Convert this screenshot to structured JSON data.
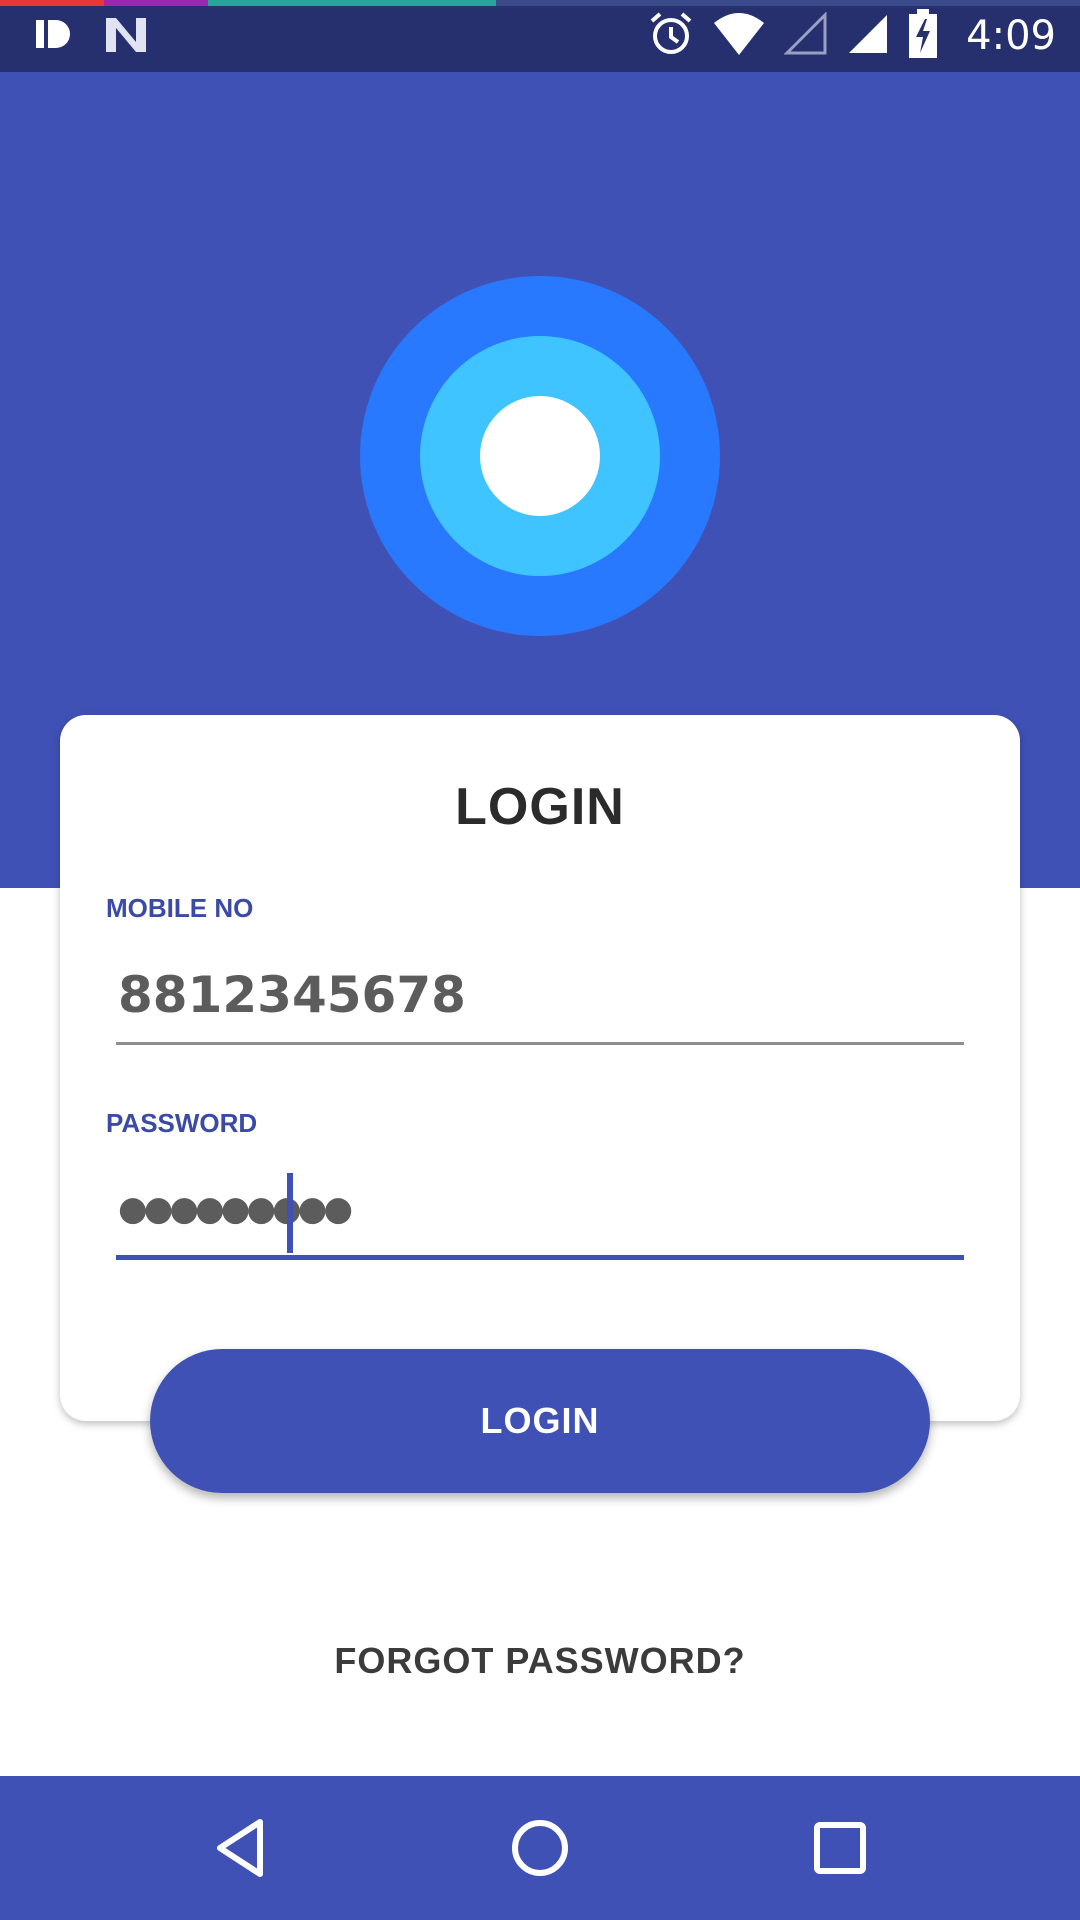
{
  "status_bar": {
    "time": "4:09",
    "left_icons": [
      "id-app-icon",
      "n-app-icon"
    ],
    "right_icons": [
      "alarm-icon",
      "wifi-icon",
      "signal-empty-icon",
      "signal-icon",
      "battery-charging-icon"
    ]
  },
  "card": {
    "title": "LOGIN"
  },
  "form": {
    "mobile_label": "MOBILE NO",
    "mobile_value": "8812345678",
    "password_label": "PASSWORD",
    "password_value": "●●●●●●●●●"
  },
  "login_button": "LOGIN",
  "forgot_password": "FORGOT PASSWORD?",
  "navigation": {
    "icons": [
      "back-icon",
      "home-icon",
      "recents-icon"
    ]
  },
  "colors": {
    "primary": "#3f51b5",
    "status_bar": "#27306e",
    "logo_outer": "#2979ff",
    "logo_mid": "#40c4ff"
  }
}
